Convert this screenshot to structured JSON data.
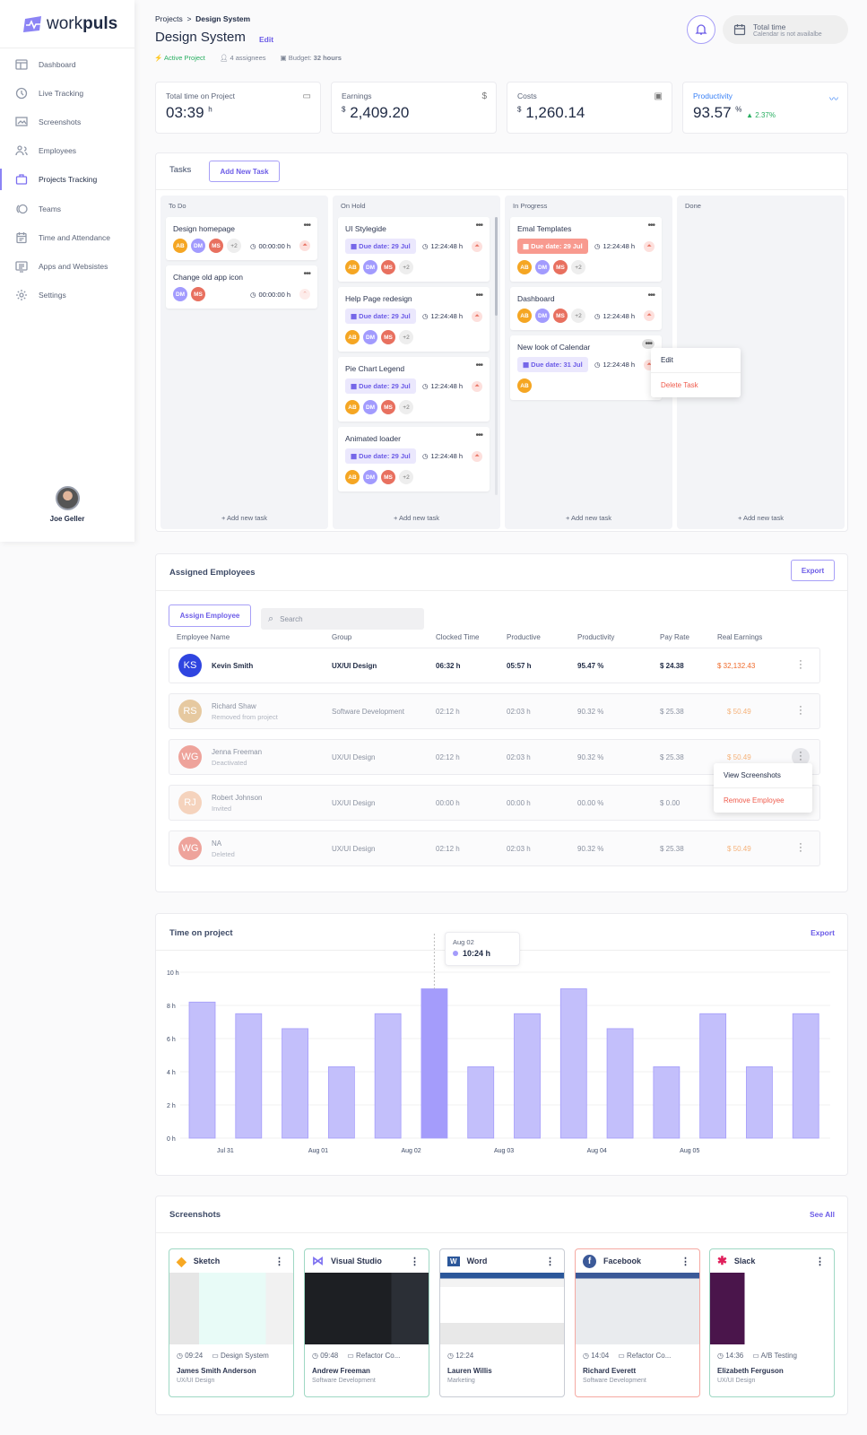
{
  "brand": {
    "name_light": "work",
    "name_bold": "puls"
  },
  "sidebar": {
    "items": [
      {
        "label": "Dashboard",
        "icon": "dashboard-icon"
      },
      {
        "label": "Live Tracking",
        "icon": "clock-icon"
      },
      {
        "label": "Screenshots",
        "icon": "image-icon"
      },
      {
        "label": "Employees",
        "icon": "users-icon"
      },
      {
        "label": "Projects Tracking",
        "icon": "briefcase-icon",
        "active": true
      },
      {
        "label": "Teams",
        "icon": "teams-icon"
      },
      {
        "label": "Time and Attendance",
        "icon": "calendar-icon"
      },
      {
        "label": "Apps and Websistes",
        "icon": "monitor-icon"
      },
      {
        "label": "Settings",
        "icon": "gear-icon"
      }
    ],
    "user": "Joe Geller"
  },
  "header": {
    "breadcrumb": [
      "Projects",
      "Design System"
    ],
    "title": "Design System",
    "edit": "Edit",
    "status": "Active Project",
    "assignees": "4 assignees",
    "budget_label": "Budget:",
    "budget_value": "32 hours",
    "total_time": "Total time",
    "calendar_note": "Calendar is not availalbe"
  },
  "stats": [
    {
      "label": "Total time on Project",
      "prefix": "",
      "value": "03:39",
      "unit": "h",
      "icon": "briefcase-icon"
    },
    {
      "label": "Earnings",
      "prefix": "$",
      "value": "2,409.20",
      "unit": "",
      "icon": "clipboard-dollar-icon"
    },
    {
      "label": "Costs",
      "prefix": "$",
      "value": "1,260.14",
      "unit": "",
      "icon": "wallet-icon"
    },
    {
      "label": "Productivity",
      "prefix": "",
      "value": "93.57",
      "unit": "%",
      "change": "▲ 2.37%",
      "icon": "trend-icon"
    }
  ],
  "colors": {
    "accent": "#6c5ce7",
    "AB": "#f5a623",
    "DM": "#a29bfe",
    "MS": "#e8705f",
    "positive": "#27ae60",
    "danger": "#ef5b4c"
  },
  "tasks": {
    "title": "Tasks",
    "add_button": "Add New Task",
    "add_task": "+ Add new task",
    "due_label": "Due date:",
    "columns": [
      {
        "name": "To Do",
        "cards": [
          {
            "title": "Design homepage",
            "assignees": [
              "AB",
              "DM",
              "MS"
            ],
            "extra": "+2",
            "time": "00:00:00 h",
            "priority": "high",
            "inline": true
          },
          {
            "title": "Change old app icon",
            "assignees": [
              "DM",
              "MS"
            ],
            "time": "00:00:00 h",
            "priority": "low",
            "inline": true
          }
        ]
      },
      {
        "name": "On Hold",
        "cards": [
          {
            "title": "UI Stylegide",
            "due": "29 Jul",
            "time": "12:24:48 h",
            "assignees": [
              "AB",
              "DM",
              "MS"
            ],
            "extra": "+2",
            "priority": "high"
          },
          {
            "title": "Help Page redesign",
            "due": "29 Jul",
            "time": "12:24:48 h",
            "assignees": [
              "AB",
              "DM",
              "MS"
            ],
            "extra": "+2",
            "priority": "high"
          },
          {
            "title": "Pie Chart Legend",
            "due": "29 Jul",
            "time": "12:24:48 h",
            "assignees": [
              "AB",
              "DM",
              "MS"
            ],
            "extra": "+2",
            "priority": "high"
          },
          {
            "title": "Animated loader",
            "due": "29 Jul",
            "time": "12:24:48 h",
            "assignees": [
              "AB",
              "DM",
              "MS"
            ],
            "extra": "+2",
            "priority": "high"
          }
        ]
      },
      {
        "name": "In Progress",
        "cards": [
          {
            "title": "Emal Templates",
            "due": "29 Jul",
            "overdue": true,
            "time": "12:24:48 h",
            "assignees": [
              "AB",
              "DM",
              "MS"
            ],
            "extra": "+2",
            "priority": "high"
          },
          {
            "title": "Dashboard",
            "assignees": [
              "AB",
              "DM",
              "MS"
            ],
            "extra": "+2",
            "time": "12:24:48 h",
            "priority": "high",
            "inline": true
          },
          {
            "title": "New look of Calendar",
            "due": "31 Jul",
            "time": "12:24:48 h",
            "assignees": [
              "AB"
            ],
            "priority": "high"
          }
        ]
      },
      {
        "name": "Done",
        "cards": []
      }
    ],
    "context_menu": {
      "edit": "Edit",
      "delete": "Delete Task"
    }
  },
  "employees": {
    "title": "Assigned Employees",
    "export": "Export",
    "assign": "Assign Employee",
    "search_placeholder": "Search",
    "headers": [
      "Employee Name",
      "Group",
      "Clocked Time",
      "Productive",
      "Productivity",
      "Pay Rate",
      "Real Earnings"
    ],
    "rows": [
      {
        "initials": "KS",
        "color": "#2f45e0",
        "name": "Kevin Smith",
        "status": "",
        "group": "UX/UI Design",
        "clocked": "06:32 h",
        "productive": "05:57 h",
        "productivity": "95.47 %",
        "rate": "$ 24.38",
        "earnings": "$ 32,132.43"
      },
      {
        "initials": "RS",
        "color": "#e6c9a0",
        "name": "Richard Shaw",
        "status": "Removed from project",
        "group": "Software Development",
        "clocked": "02:12 h",
        "productive": "02:03 h",
        "productivity": "90.32 %",
        "rate": "$ 25.38",
        "earnings": "$ 50.49"
      },
      {
        "initials": "WG",
        "color": "#eea39b",
        "name": "Jenna Freeman",
        "status": "Deactivated",
        "group": "UX/UI Design",
        "clocked": "02:12 h",
        "productive": "02:03 h",
        "productivity": "90.32 %",
        "rate": "$ 25.38",
        "earnings": "$ 50.49"
      },
      {
        "initials": "RJ",
        "color": "#f5d3bd",
        "name": "Robert Johnson",
        "status": "Invited",
        "group": "UX/UI Design",
        "clocked": "00:00 h",
        "productive": "00:00 h",
        "productivity": "00.00 %",
        "rate": "$ 0.00",
        "earnings": ""
      },
      {
        "initials": "WG",
        "color": "#eea39b",
        "name": "NA",
        "status": "Deleted",
        "group": "UX/UI Design",
        "clocked": "02:12 h",
        "productive": "02:03 h",
        "productivity": "90.32 %",
        "rate": "$ 25.38",
        "earnings": "$ 50.49"
      }
    ],
    "context_menu": {
      "view": "View Screenshots",
      "remove": "Remove Employee"
    }
  },
  "chart_data": {
    "type": "bar",
    "title": "Time on project",
    "export": "Export",
    "ylim": [
      0,
      10
    ],
    "yticks": [
      "0 h",
      "2 h",
      "4 h",
      "6 h",
      "8 h",
      "10 h"
    ],
    "ytick_values": [
      0,
      2,
      4,
      6,
      8,
      10
    ],
    "x_labels": [
      "Jul 31",
      "Aug 01",
      "Aug 02",
      "Aug 03",
      "Aug 04",
      "Aug 05"
    ],
    "values": [
      8.2,
      7.5,
      6.6,
      4.3,
      7.5,
      9.0,
      4.3,
      7.5,
      9.0,
      6.6,
      4.3,
      7.5,
      4.3,
      7.5
    ],
    "highlight_index": 5,
    "bar_color": "#c3bffb",
    "highlight_color": "#a49cfb",
    "tooltip": {
      "date": "Aug 02",
      "value": "10:24 h"
    },
    "grid": true
  },
  "screenshots": {
    "title": "Screenshots",
    "see_all": "See All",
    "items": [
      {
        "app": "Sketch",
        "time": "09:24",
        "project": "Design System",
        "name": "James Smith Anderson",
        "group": "UX/UI Design",
        "border": "#9fd8c4"
      },
      {
        "app": "Visual Studio",
        "time": "09:48",
        "project": "Refactor Co...",
        "name": "Andrew Freeman",
        "group": "Software Development",
        "border": "#9fd8c4"
      },
      {
        "app": "Word",
        "time": "12:24",
        "project": "",
        "name": "Lauren Willis",
        "group": "Marketing",
        "border": "#c8ccd4"
      },
      {
        "app": "Facebook",
        "time": "14:04",
        "project": "Refactor Co...",
        "name": "Richard Everett",
        "group": "Software Development",
        "border": "#f5a9a2"
      },
      {
        "app": "Slack",
        "time": "14:36",
        "project": "A/B Testing",
        "name": "Elizabeth Ferguson",
        "group": "UX/UI Design",
        "border": "#9fd8c4"
      }
    ]
  }
}
